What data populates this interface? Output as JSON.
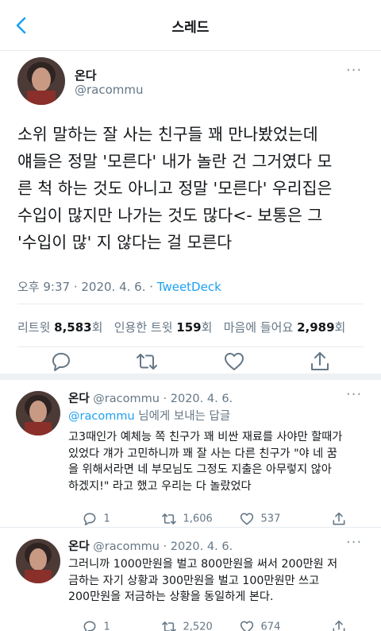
{
  "header": {
    "title": "스레드",
    "back_icon": "chevron-left-icon"
  },
  "main_tweet": {
    "name": "온다",
    "handle": "@racommu",
    "more": "···",
    "text": "소위 말하는 잘 사는 친구들 꽤 만나봤었는데\n얘들은 정말 '모른다' 내가 놀란 건 그거였다 모\n른 척 하는 것도 아니고 정말 '모른다' 우리집은\n수입이 많지만 나가는 것도 많다<- 보통은 그\n'수입이 많' 지 않다는 걸 모른다",
    "time": "오후 9:37 · 2020. 4. 6. · ",
    "source": "TweetDeck",
    "retweets_label": "리트윗 ",
    "retweets": "8,583",
    "retweets_unit": "회",
    "quotes_label": "   인용한 트윗 ",
    "quotes": "159",
    "quotes_unit": "회",
    "likes_label": "   마음에 들어요 ",
    "likes": "2,989",
    "likes_unit": "회"
  },
  "replies": [
    {
      "name": "온다",
      "handle_date": " @racommu · 2020. 4. 6.",
      "more": "···",
      "replying_mention": "@racommu",
      "replying_suffix": " 님에게 보내는 답글",
      "text": "고3때인가 예체능 쪽 친구가 꽤 비싼 재료를 사야만 할때가\n있었다 걔가 고민하니까 꽤 잘 사는 다른 친구가 \"야 네 꿈\n을 위해서라면 네 부모님도 그정도 지출은 아무렇지 않아\n하겠지!\" 라고 했고 우리는 다 놀랐었다",
      "reply_count": "1",
      "retweet_count": "1,606",
      "like_count": "537"
    },
    {
      "name": "온다",
      "handle_date": " @racommu · 2020. 4. 6.",
      "more": "···",
      "text": "그러니까 1000만원을 벌고 800만원을 써서 200만원 저\n금하는 자기 상황과 300만원을 벌고 100만원만 쓰고\n200만원을 저금하는 상황을 동일하게 본다.",
      "reply_count": "1",
      "retweet_count": "2,520",
      "like_count": "674"
    }
  ],
  "colors": {
    "accent": "#1da1f2",
    "muted": "#657786",
    "text": "#14171a"
  }
}
